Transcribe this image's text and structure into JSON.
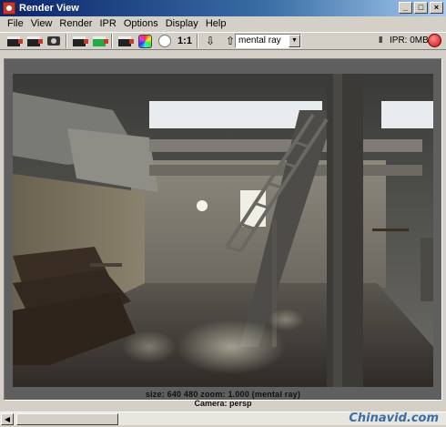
{
  "window": {
    "title": "Render View",
    "icon": "render-view-icon",
    "buttons": [
      "_",
      "□",
      "×"
    ]
  },
  "menu": [
    "File",
    "View",
    "Render",
    "IPR",
    "Options",
    "Display",
    "Help"
  ],
  "toolbar": {
    "buttons": [
      {
        "name": "redo-previous-render-icon"
      },
      {
        "name": "render-region-icon"
      },
      {
        "name": "snapshot-icon"
      },
      {
        "name": "redo-ipr-render-icon"
      },
      {
        "name": "ipr-region-icon"
      },
      {
        "name": "render-settings-icon"
      },
      {
        "name": "rgb-channels-icon"
      },
      {
        "name": "alpha-channel-icon"
      },
      {
        "name": "real-size-icon"
      },
      {
        "name": "keep-image-icon"
      },
      {
        "name": "remove-image-icon"
      },
      {
        "name": "render-globals-icon"
      }
    ],
    "ratio_label": "1:1",
    "renderer": "mental ray",
    "pause_symbol": "II",
    "ipr_memory": "IPR: 0MB"
  },
  "status": {
    "info_line": "size:  640   480 zoom: 1.000      (mental ray)",
    "camera_line": "Camera: persp"
  },
  "watermark": "Chinavid.com",
  "colors": {
    "titlebar_start": "#0a246a",
    "titlebar_end": "#a6caf0",
    "chrome": "#d4d0c8",
    "viewport": "#5f5f5f"
  }
}
